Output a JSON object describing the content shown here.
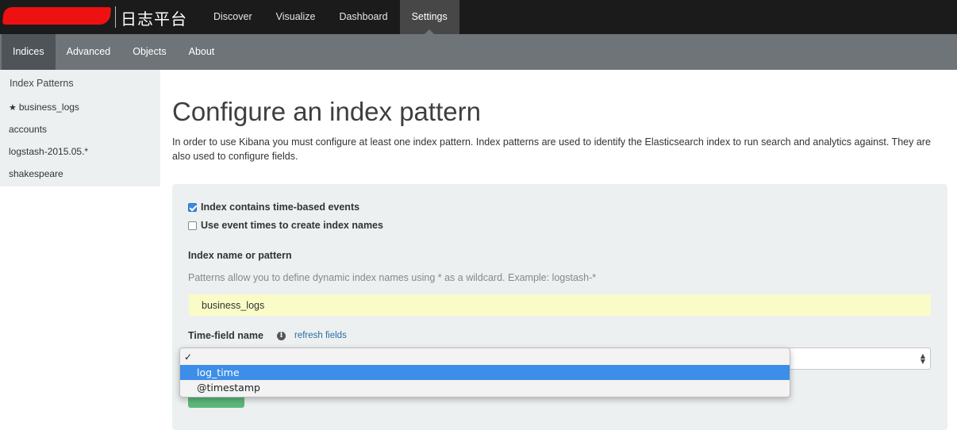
{
  "topbar": {
    "brand_title": "日志平台",
    "nav": [
      {
        "label": "Discover"
      },
      {
        "label": "Visualize"
      },
      {
        "label": "Dashboard"
      },
      {
        "label": "Settings",
        "active": true
      }
    ]
  },
  "subnav": [
    {
      "label": "Indices",
      "active": true
    },
    {
      "label": "Advanced"
    },
    {
      "label": "Objects"
    },
    {
      "label": "About"
    }
  ],
  "sidebar": {
    "heading": "Index Patterns",
    "items": [
      {
        "label": "business_logs",
        "default": true,
        "icon": "star-icon"
      },
      {
        "label": "accounts"
      },
      {
        "label": "logstash-2015.05.*"
      },
      {
        "label": "shakespeare"
      }
    ]
  },
  "main": {
    "title": "Configure an index pattern",
    "description": "In order to use Kibana you must configure at least one index pattern. Index patterns are used to identify the Elasticsearch index to run search and analytics against. They are also used to configure fields."
  },
  "form": {
    "time_based_label": "Index contains time-based events",
    "time_based_checked": true,
    "event_times_label": "Use event times to create index names",
    "event_times_checked": false,
    "index_label": "Index name or pattern",
    "index_help": "Patterns allow you to define dynamic index names using * as a wildcard. Example: logstash-*",
    "index_value": "business_logs",
    "time_field_label": "Time-field name",
    "refresh_label": "refresh fields",
    "time_field_selected": "",
    "options": [
      {
        "label": "",
        "checked": true
      },
      {
        "label": "log_time",
        "highlighted": true
      },
      {
        "label": "@timestamp"
      }
    ]
  },
  "colors": {
    "topbar": "#1b1b1b",
    "subbar": "#6f7478",
    "panel": "#ecf0f1",
    "input_highlight": "#fafcc8",
    "dropdown_highlight": "#3d8ee8",
    "create_button": "#5cb87a"
  }
}
